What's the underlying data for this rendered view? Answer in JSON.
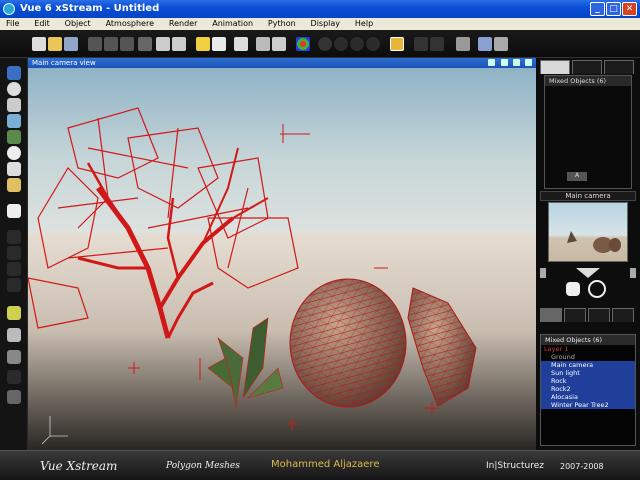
{
  "window": {
    "title": "Vue 6 xStream - Untitled",
    "minimize": "_",
    "maximize": "□",
    "close": "✕"
  },
  "menu": [
    "File",
    "Edit",
    "Object",
    "Atmosphere",
    "Render",
    "Animation",
    "Python",
    "Display",
    "Help"
  ],
  "viewport": {
    "title": "Main camera view"
  },
  "right_panel": {
    "objects_header": "Mixed Objects (6)",
    "camera_title": "Main camera",
    "layers_header": "Mixed Objects (6)",
    "ab_label": "A",
    "layers": [
      {
        "label": "Layer 1",
        "kind": "layer"
      },
      {
        "label": "Ground",
        "kind": "item"
      },
      {
        "label": "Main camera",
        "kind": "selected"
      },
      {
        "label": "Sun light",
        "kind": "selected"
      },
      {
        "label": "Rock",
        "kind": "selected"
      },
      {
        "label": "Rock2",
        "kind": "selected"
      },
      {
        "label": "Alocasia",
        "kind": "selected"
      },
      {
        "label": "Winter Pear Tree2",
        "kind": "selected"
      }
    ]
  },
  "caption": {
    "app": "Vue Xstream",
    "subject": "Polygon Meshes",
    "author": "Mohammed Aljazaere",
    "brand": "In|Structurez",
    "years": "2007-2008"
  },
  "colors": {
    "titlebar": "#0a4fd6",
    "wireframe": "#d11818",
    "selection": "#1f3f9a",
    "author_text": "#e0b84c"
  }
}
